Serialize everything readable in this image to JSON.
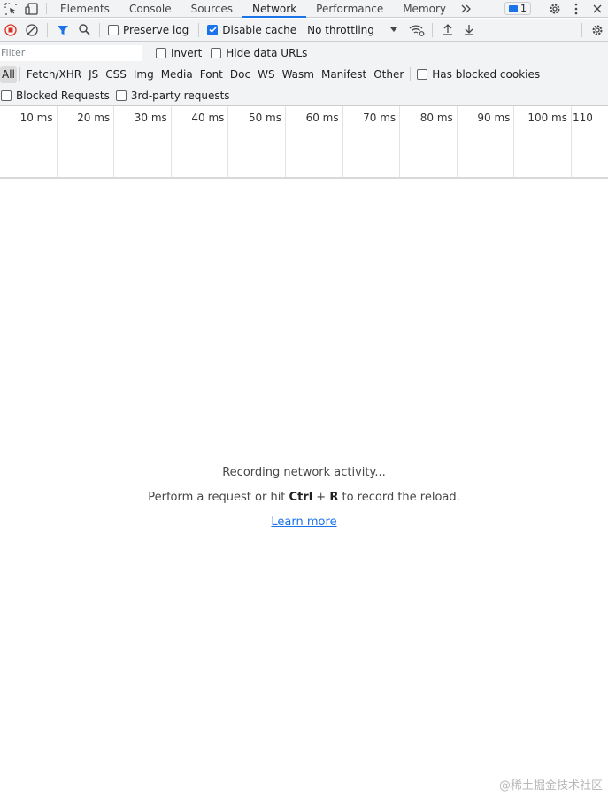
{
  "tabbar": {
    "tabs": [
      {
        "label": "Elements"
      },
      {
        "label": "Console"
      },
      {
        "label": "Sources"
      },
      {
        "label": "Network"
      },
      {
        "label": "Performance"
      },
      {
        "label": "Memory"
      }
    ],
    "active_tab": "Network",
    "message_count": "1"
  },
  "toolbar": {
    "preserve_log_label": "Preserve log",
    "preserve_log_checked": false,
    "disable_cache_label": "Disable cache",
    "disable_cache_checked": true,
    "throttling_value": "No throttling"
  },
  "filter": {
    "placeholder": "Filter",
    "invert_label": "Invert",
    "hide_data_urls_label": "Hide data URLs"
  },
  "types": {
    "items": [
      "All",
      "Fetch/XHR",
      "JS",
      "CSS",
      "Img",
      "Media",
      "Font",
      "Doc",
      "WS",
      "Wasm",
      "Manifest",
      "Other"
    ],
    "active": "All",
    "has_blocked_cookies_label": "Has blocked cookies"
  },
  "blocks": {
    "blocked_requests_label": "Blocked Requests",
    "third_party_label": "3rd-party requests"
  },
  "timeline": {
    "ticks": [
      "10 ms",
      "20 ms",
      "30 ms",
      "40 ms",
      "50 ms",
      "60 ms",
      "70 ms",
      "80 ms",
      "90 ms",
      "100 ms",
      "110"
    ]
  },
  "empty_state": {
    "line1": "Recording network activity...",
    "line2_pre": "Perform a request or hit ",
    "shortcut_ctrl": "Ctrl",
    "shortcut_plus": " + ",
    "shortcut_r": "R",
    "line2_post": " to record the reload.",
    "learn_more": "Learn more"
  },
  "watermark": "@稀土掘金技术社区",
  "colors": {
    "accent": "#1a73e8",
    "record_red": "#d93025",
    "toolbar_bg": "#f1f3f4"
  }
}
